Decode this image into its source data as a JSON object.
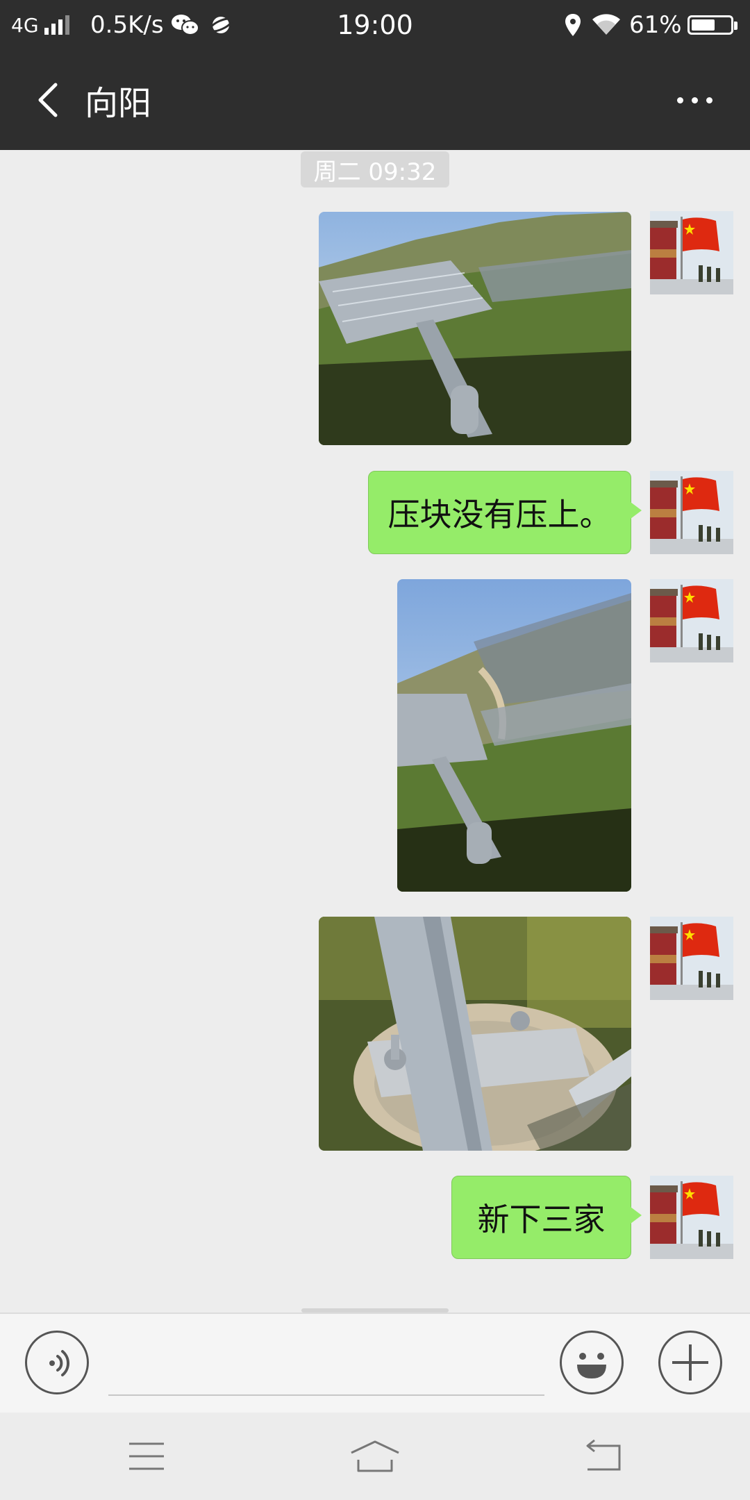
{
  "status_bar": {
    "network": "4G",
    "speed": "0.5K/s",
    "time": "19:00",
    "battery_percent": "61%",
    "battery_level": 0.61,
    "icons": [
      "signal-icon",
      "wechat-icon",
      "planet-icon",
      "location-icon",
      "wifi-icon",
      "battery-icon"
    ]
  },
  "header": {
    "title": "向阳",
    "icons": [
      "back-icon",
      "more-icon"
    ]
  },
  "chat": {
    "timestamp": "周二 09:32",
    "messages": [
      {
        "type": "image",
        "description_icon": "solar-panel-photo"
      },
      {
        "type": "text",
        "text": "压块没有压上。"
      },
      {
        "type": "image",
        "description_icon": "solar-panel-photo"
      },
      {
        "type": "image",
        "description_icon": "pole-base-photo"
      },
      {
        "type": "text",
        "text": "新下三家"
      }
    ],
    "avatar_icon": "flag-avatar"
  },
  "input_bar": {
    "placeholder": "",
    "icons": [
      "voice-icon",
      "emoji-icon",
      "plus-icon"
    ]
  },
  "nav_bar": {
    "icons": [
      "menu-icon",
      "home-icon",
      "return-icon"
    ]
  },
  "colors": {
    "header_bg": "#2e2e2e",
    "chat_bg": "#ededed",
    "bubble": "#95ec69",
    "flag_red": "#de2910",
    "flag_yellow": "#ffde00"
  }
}
